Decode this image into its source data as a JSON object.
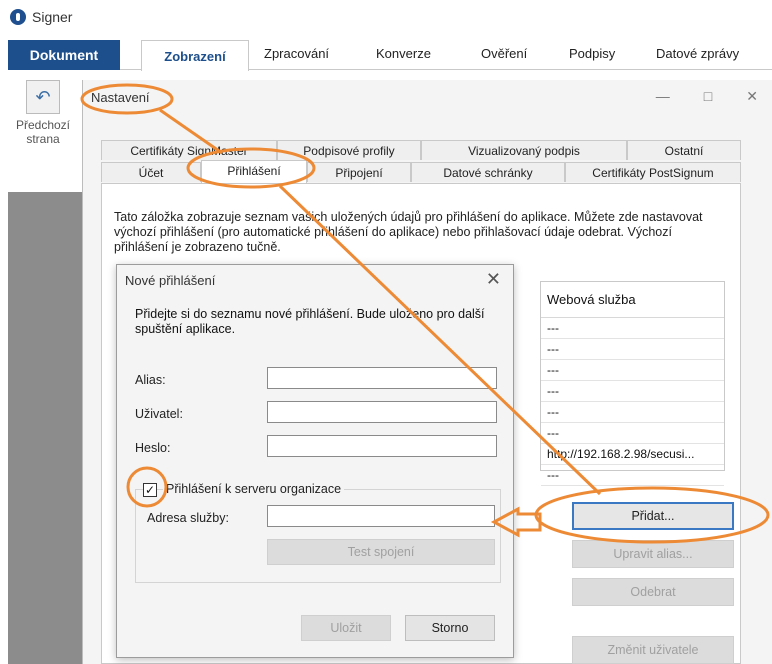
{
  "app": {
    "title": "Signer"
  },
  "ribbon": {
    "tabs": [
      "Dokument",
      "Zobrazení",
      "Zpracování",
      "Konverze",
      "Ověření",
      "Podpisy",
      "Datové zprávy"
    ]
  },
  "toolbar": {
    "back_label_line1": "Předchozí",
    "back_label_line2": "strana"
  },
  "settings": {
    "title": "Nastavení",
    "tabs_row1": [
      "Certifikáty SignMaster",
      "Podpisové profily",
      "Vizualizovaný podpis",
      "Ostatní"
    ],
    "tabs_row2": [
      "Účet",
      "Přihlášení",
      "Připojení",
      "Datové schránky",
      "Certifikáty PostSignum"
    ],
    "description": "Tato záložka zobrazuje seznam vašich uložených údajů pro přihlášení do aplikace. Můžete zde nastavovat výchozí přihlášení (pro automatické přihlášení do aplikace) nebo přihlašovací údaje odebrat. Výchozí přihlášení je zobrazeno tučně.",
    "table": {
      "header": "Webová služba",
      "rows": [
        "---",
        "---",
        "---",
        "---",
        "---",
        "---",
        "http://192.168.2.98/secusi...",
        "---"
      ]
    },
    "buttons": {
      "add": "Přidat...",
      "edit": "Upravit alias...",
      "remove": "Odebrat",
      "change_user": "Změnit uživatele"
    }
  },
  "new_login": {
    "title": "Nové přihlášení",
    "description": "Přidejte si do seznamu nové přihlášení. Bude uloženo pro další spuštění aplikace.",
    "alias_label": "Alias:",
    "user_label": "Uživatel:",
    "password_label": "Heslo:",
    "org_checkbox_label": "Přihlášení k serveru organizace",
    "org_checked": true,
    "service_address_label": "Adresa služby:",
    "test_button": "Test spojení",
    "save_button": "Uložit",
    "cancel_button": "Storno"
  },
  "colors": {
    "accent": "#1d4f8c",
    "annotation": "#ed8a35",
    "focus": "#3a78c4"
  }
}
